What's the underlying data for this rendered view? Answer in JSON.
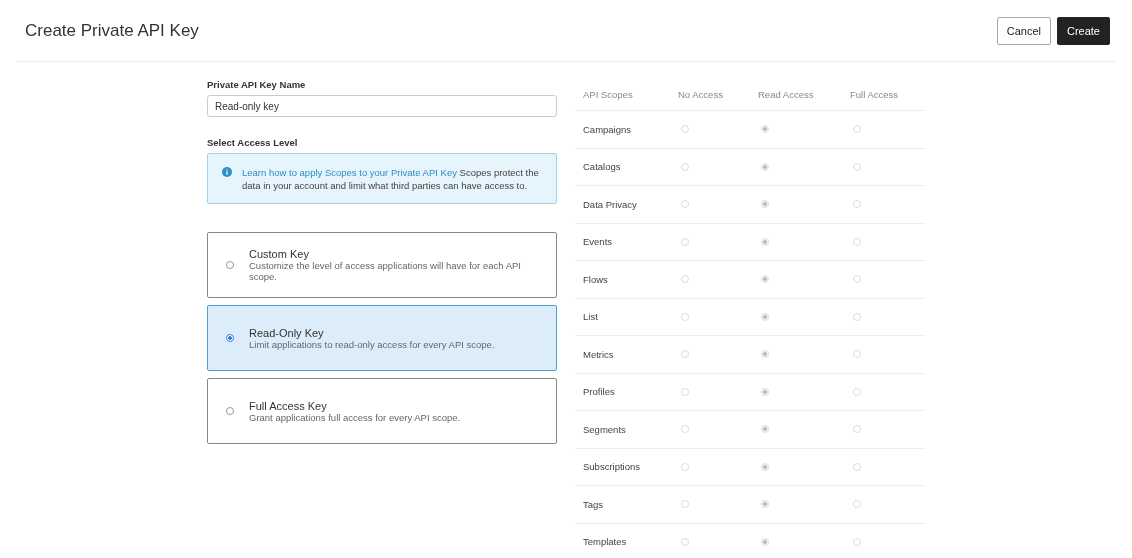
{
  "header": {
    "title": "Create Private API Key",
    "buttons": [
      {
        "label": "Cancel",
        "kind": "secondary"
      },
      {
        "label": "Create",
        "kind": "primary"
      }
    ]
  },
  "form": {
    "name_label": "Private API Key Name",
    "name_value": "Read-only key",
    "access_label": "Select Access Level",
    "info": {
      "link": "Learn how to apply Scopes to your Private API Key",
      "text": " Scopes protect the data in your account and limit what third parties can have access to."
    },
    "key_options": [
      {
        "title": "Custom Key",
        "description": "Customize the level of access applications will have for each API scope.",
        "selected": false
      },
      {
        "title": "Read-Only Key",
        "description": "Limit applications to read-only access for every API scope.",
        "selected": true
      },
      {
        "title": "Full Access Key",
        "description": "Grant applications full access for every API scope.",
        "selected": false
      }
    ]
  },
  "scopes": {
    "columns": [
      "API Scopes",
      "No Access",
      "Read Access",
      "Full Access"
    ],
    "rows": [
      {
        "name": "Campaigns",
        "options": [
          {
            "selected": false
          },
          {
            "selected": true
          },
          {
            "selected": false
          }
        ]
      },
      {
        "name": "Catalogs",
        "options": [
          {
            "selected": false
          },
          {
            "selected": true
          },
          {
            "selected": false
          }
        ]
      },
      {
        "name": "Data Privacy",
        "options": [
          {
            "selected": false
          },
          {
            "selected": true
          },
          {
            "selected": false
          }
        ]
      },
      {
        "name": "Events",
        "options": [
          {
            "selected": false
          },
          {
            "selected": true
          },
          {
            "selected": false
          }
        ]
      },
      {
        "name": "Flows",
        "options": [
          {
            "selected": false
          },
          {
            "selected": true
          },
          {
            "selected": false
          }
        ]
      },
      {
        "name": "List",
        "options": [
          {
            "selected": false
          },
          {
            "selected": true
          },
          {
            "selected": false
          }
        ]
      },
      {
        "name": "Metrics",
        "options": [
          {
            "selected": false
          },
          {
            "selected": true
          },
          {
            "selected": false
          }
        ]
      },
      {
        "name": "Profiles",
        "options": [
          {
            "selected": false
          },
          {
            "selected": true
          },
          {
            "selected": false
          }
        ]
      },
      {
        "name": "Segments",
        "options": [
          {
            "selected": false
          },
          {
            "selected": true
          },
          {
            "selected": false
          }
        ]
      },
      {
        "name": "Subscriptions",
        "options": [
          {
            "selected": false
          },
          {
            "selected": true
          },
          {
            "selected": false
          }
        ]
      },
      {
        "name": "Tags",
        "options": [
          {
            "selected": false
          },
          {
            "selected": true
          },
          {
            "selected": false
          }
        ]
      },
      {
        "name": "Templates",
        "options": [
          {
            "selected": false
          },
          {
            "selected": true
          },
          {
            "selected": false
          }
        ]
      }
    ]
  }
}
